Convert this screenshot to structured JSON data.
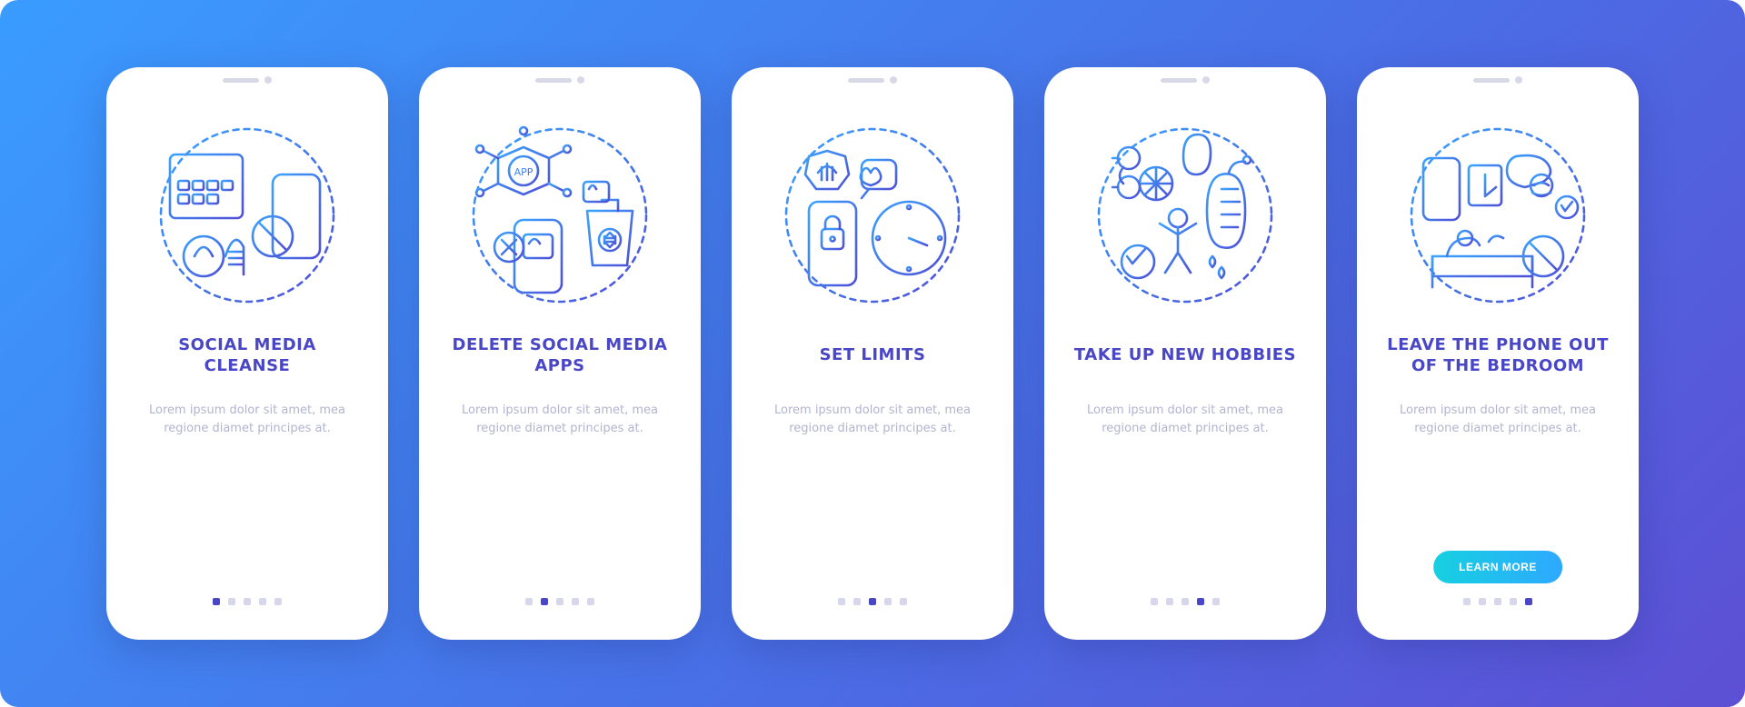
{
  "colors": {
    "accent": "#4a47c7",
    "grad_from": "#3aa4ff",
    "grad_to": "#4f4fd6",
    "cta_from": "#16d0e0",
    "cta_to": "#2ea9ff"
  },
  "screens": [
    {
      "icon": "cleanse-icon",
      "title": "SOCIAL MEDIA CLEANSE",
      "body": "Lorem ipsum dolor sit amet, mea regione diamet principes at.",
      "active_dot": 0,
      "cta": null
    },
    {
      "icon": "delete-apps-icon",
      "title": "DELETE SOCIAL MEDIA APPS",
      "body": "Lorem ipsum dolor sit amet, mea regione diamet principes at.",
      "active_dot": 1,
      "cta": null
    },
    {
      "icon": "set-limits-icon",
      "title": "SET LIMITS",
      "body": "Lorem ipsum dolor sit amet, mea regione diamet principes at.",
      "active_dot": 2,
      "cta": null
    },
    {
      "icon": "hobbies-icon",
      "title": "TAKE UP NEW HOBBIES",
      "body": "Lorem ipsum dolor sit amet, mea regione diamet principes at.",
      "active_dot": 3,
      "cta": null
    },
    {
      "icon": "bedroom-icon",
      "title": "LEAVE THE PHONE OUT OF THE BEDROOM",
      "body": "Lorem ipsum dolor sit amet, mea regione diamet principes at.",
      "active_dot": 4,
      "cta": "LEARN MORE"
    }
  ],
  "dot_count": 5
}
